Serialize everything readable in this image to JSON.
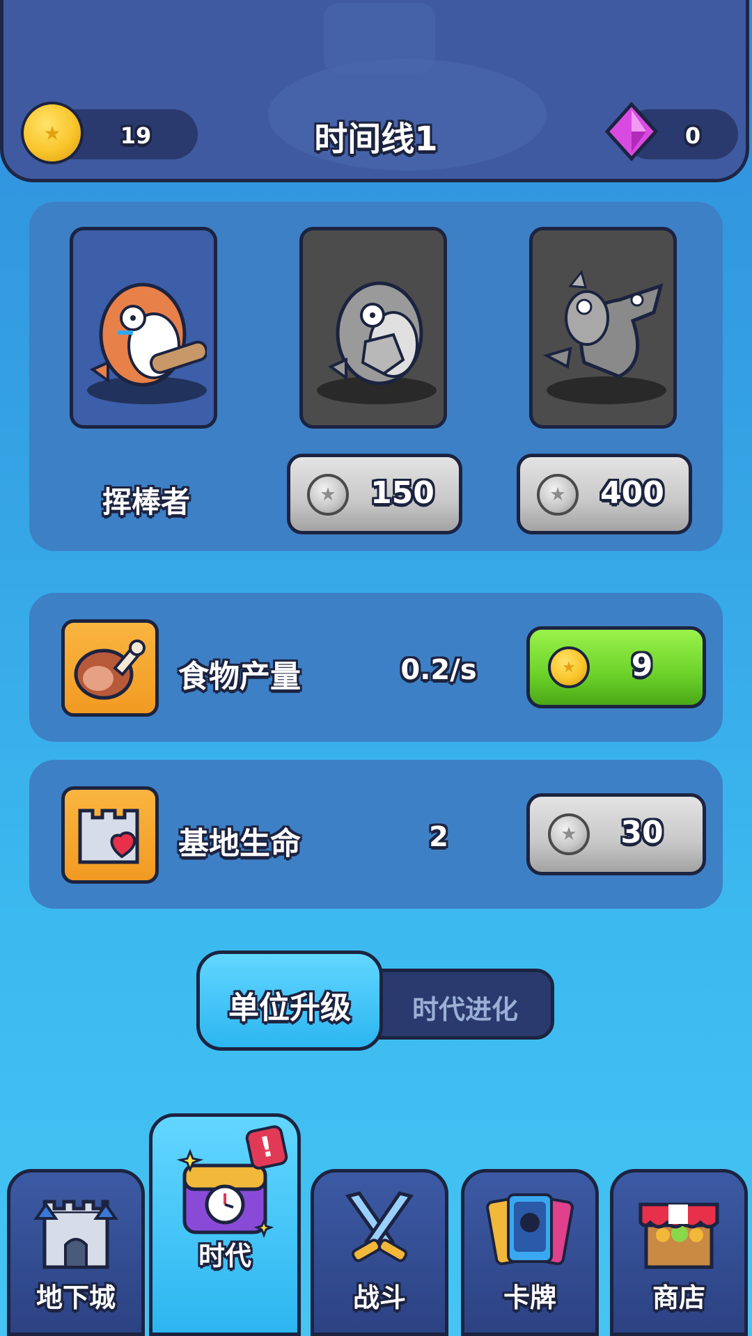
{
  "header": {
    "title": "时间线1",
    "coins": "19",
    "gems": "0"
  },
  "units": [
    {
      "name": "挥棒者",
      "locked": false
    },
    {
      "cost": "150",
      "locked": true
    },
    {
      "cost": "400",
      "locked": true
    }
  ],
  "upgrades": [
    {
      "label": "食物产量",
      "value": "0.2/s",
      "cost": "9",
      "affordable": true,
      "icon": "meat-icon"
    },
    {
      "label": "基地生命",
      "value": "2",
      "cost": "30",
      "affordable": false,
      "icon": "castle-heart-icon"
    }
  ],
  "toggle": {
    "active": "单位升级",
    "inactive": "时代进化"
  },
  "nav": [
    {
      "label": "地下城",
      "icon": "castle-icon"
    },
    {
      "label": "时代",
      "icon": "era-chest-icon",
      "active": true,
      "badge": "!"
    },
    {
      "label": "战斗",
      "icon": "crossed-swords-icon"
    },
    {
      "label": "卡牌",
      "icon": "cards-icon"
    },
    {
      "label": "商店",
      "icon": "shop-icon"
    }
  ],
  "colors": {
    "background": "#3cb0ee",
    "header": "#3f5aa0",
    "outline": "#1c2340",
    "green_button": "#6cd22a",
    "grey_button": "#c8c8c8",
    "active_tab": "#2cb6f0",
    "coin": "#f9c52b",
    "gem": "#d94ae0"
  }
}
